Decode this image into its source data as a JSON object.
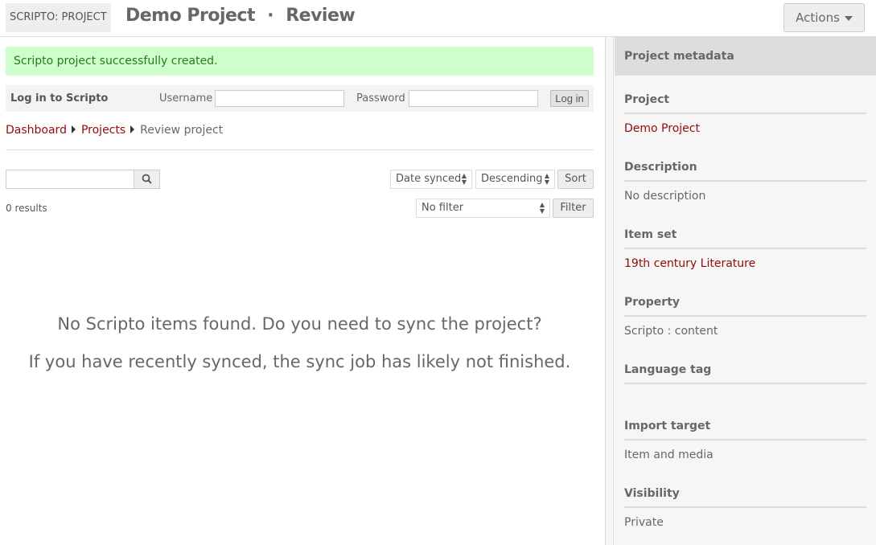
{
  "header": {
    "brand": "SCRIPTO: PROJECT",
    "title": "Demo Project",
    "separator": "·",
    "subtitle": "Review",
    "actions_label": "Actions"
  },
  "message": "Scripto project successfully created.",
  "login": {
    "title": "Log in to Scripto",
    "username_label": "Username",
    "password_label": "Password",
    "username_value": "",
    "password_value": "",
    "button": "Log in"
  },
  "breadcrumbs": [
    {
      "label": "Dashboard"
    },
    {
      "label": "Projects"
    },
    {
      "label": "Review project"
    }
  ],
  "toolbar": {
    "search_value": "",
    "sort_by": "Date synced",
    "sort_order": "Descending",
    "sort_button": "Sort",
    "filter": "No filter",
    "filter_button": "Filter",
    "results": "0 results"
  },
  "empty": {
    "line1": "No Scripto items found. Do you need to sync the project?",
    "line2": "If you have recently synced, the sync job has likely not finished."
  },
  "sidebar": {
    "title": "Project metadata",
    "fields": [
      {
        "label": "Project",
        "value": "Demo Project"
      },
      {
        "label": "Description",
        "value": "No description"
      },
      {
        "label": "Item set",
        "value": "19th century Literature"
      },
      {
        "label": "Property",
        "value": "Scripto : content"
      },
      {
        "label": "Language tag",
        "value": ""
      },
      {
        "label": "Import target",
        "value": "Item and media"
      },
      {
        "label": "Visibility",
        "value": "Private"
      }
    ]
  },
  "colors": {
    "link": "#920b0b",
    "success_bg": "#ccffcc",
    "success_text": "#2a7a1a"
  }
}
